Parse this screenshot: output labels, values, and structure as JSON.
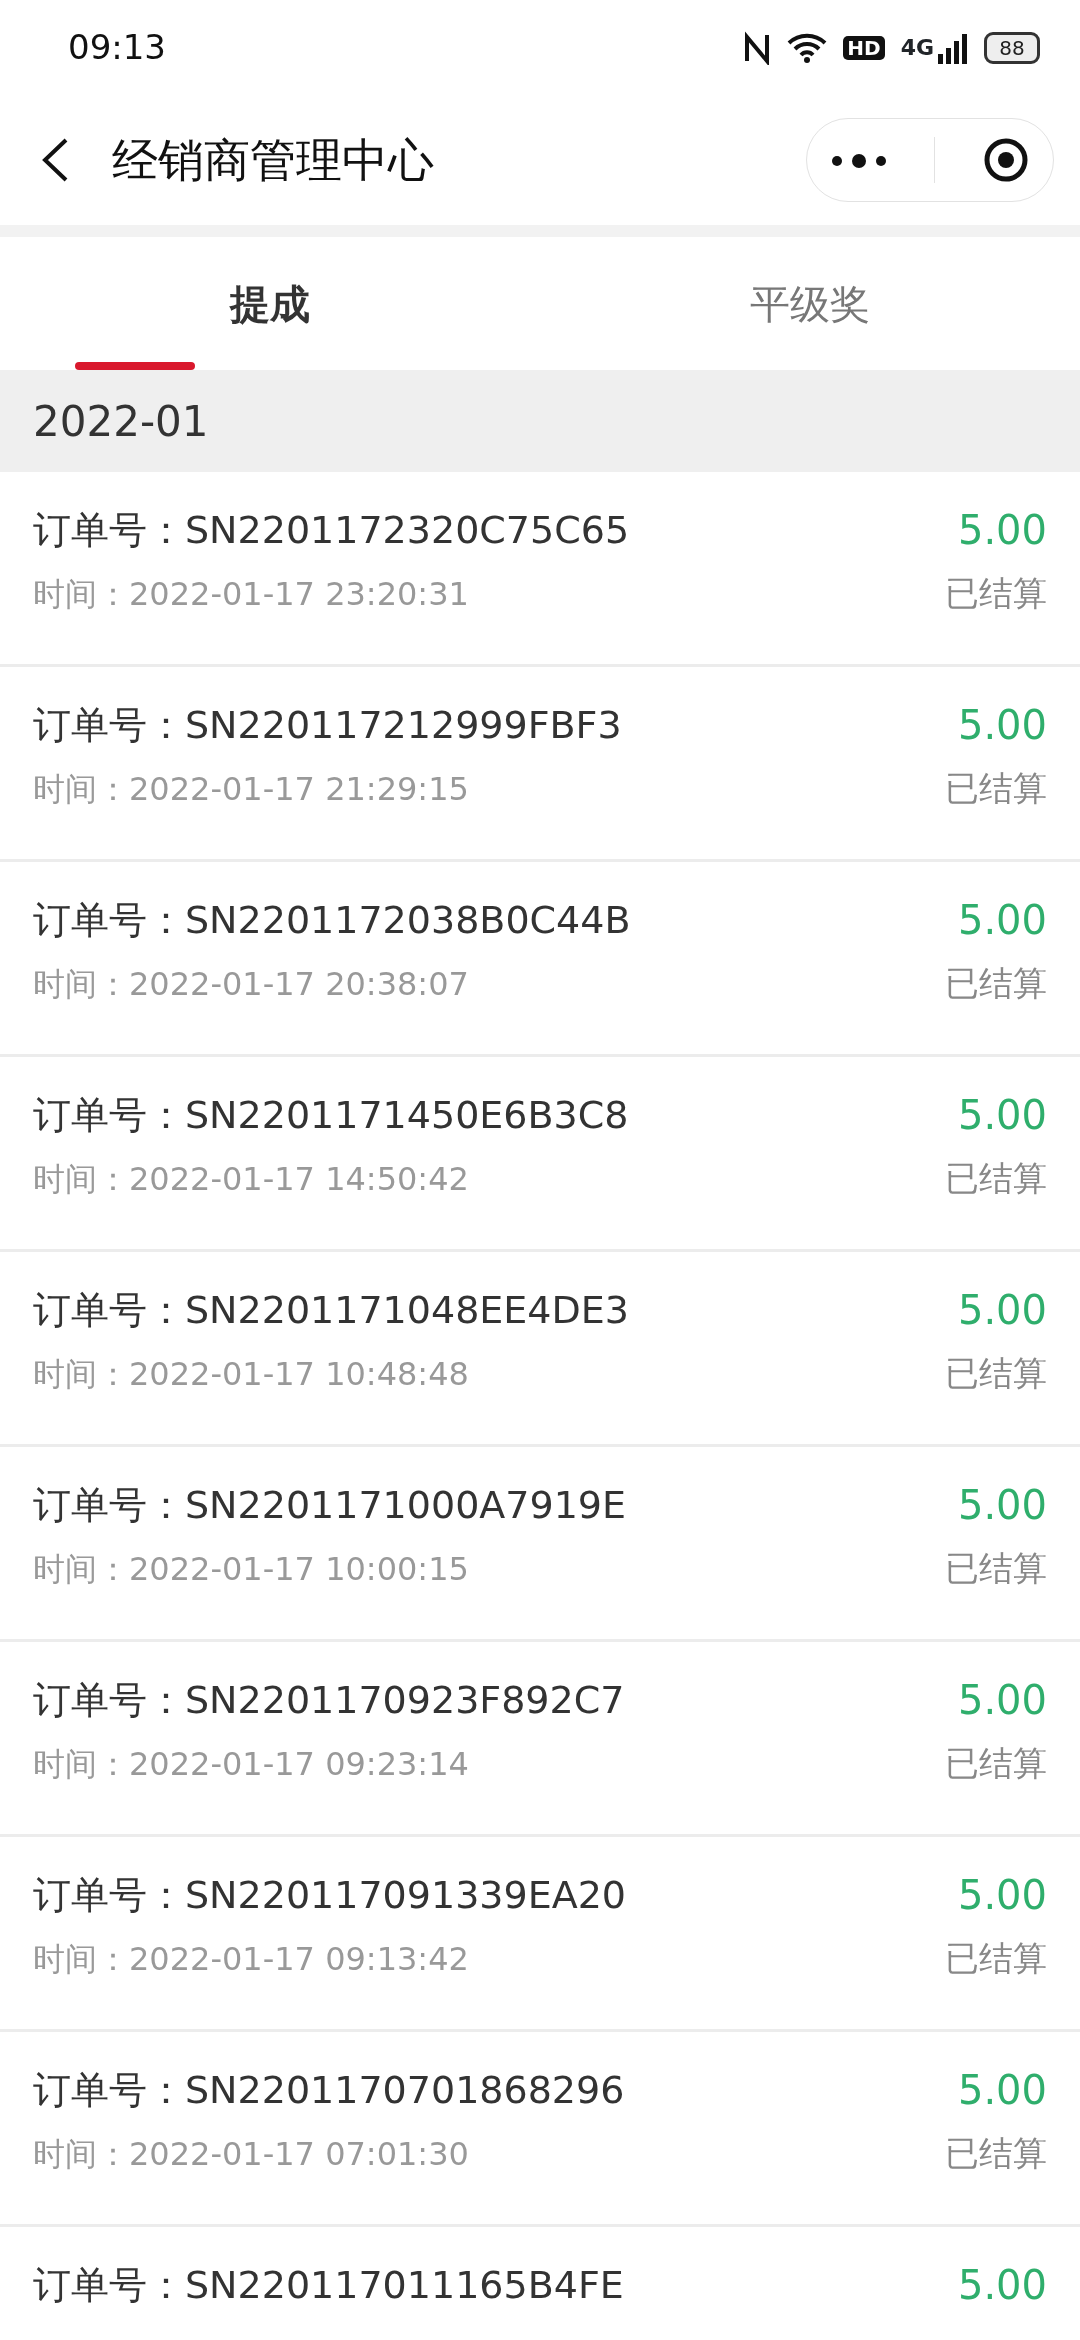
{
  "status_bar": {
    "time": "09:13",
    "hd": "HD",
    "network": "4G",
    "battery": "88"
  },
  "header": {
    "title": "经销商管理中心"
  },
  "tabs": [
    {
      "label": "提成",
      "selected": true
    },
    {
      "label": "平级奖",
      "selected": false
    }
  ],
  "month": "2022-01",
  "orders": [
    {
      "order_label": "订单号：",
      "order_no": "SN2201172320C75C65",
      "amount": "5.00",
      "time_label": "时间：",
      "time": "2022-01-17 23:20:31",
      "status": "已结算"
    },
    {
      "order_label": "订单号：",
      "order_no": "SN220117212999FBF3",
      "amount": "5.00",
      "time_label": "时间：",
      "time": "2022-01-17 21:29:15",
      "status": "已结算"
    },
    {
      "order_label": "订单号：",
      "order_no": "SN2201172038B0C44B",
      "amount": "5.00",
      "time_label": "时间：",
      "time": "2022-01-17 20:38:07",
      "status": "已结算"
    },
    {
      "order_label": "订单号：",
      "order_no": "SN2201171450E6B3C8",
      "amount": "5.00",
      "time_label": "时间：",
      "time": "2022-01-17 14:50:42",
      "status": "已结算"
    },
    {
      "order_label": "订单号：",
      "order_no": "SN2201171048EE4DE3",
      "amount": "5.00",
      "time_label": "时间：",
      "time": "2022-01-17 10:48:48",
      "status": "已结算"
    },
    {
      "order_label": "订单号：",
      "order_no": "SN2201171000A7919E",
      "amount": "5.00",
      "time_label": "时间：",
      "time": "2022-01-17 10:00:15",
      "status": "已结算"
    },
    {
      "order_label": "订单号：",
      "order_no": "SN2201170923F892C7",
      "amount": "5.00",
      "time_label": "时间：",
      "time": "2022-01-17 09:23:14",
      "status": "已结算"
    },
    {
      "order_label": "订单号：",
      "order_no": "SN220117091339EA20",
      "amount": "5.00",
      "time_label": "时间：",
      "time": "2022-01-17 09:13:42",
      "status": "已结算"
    },
    {
      "order_label": "订单号：",
      "order_no": "SN2201170701868296",
      "amount": "5.00",
      "time_label": "时间：",
      "time": "2022-01-17 07:01:30",
      "status": "已结算"
    },
    {
      "order_label": "订单号：",
      "order_no": "SN220117011165B4FE",
      "amount": "5.00"
    }
  ]
}
